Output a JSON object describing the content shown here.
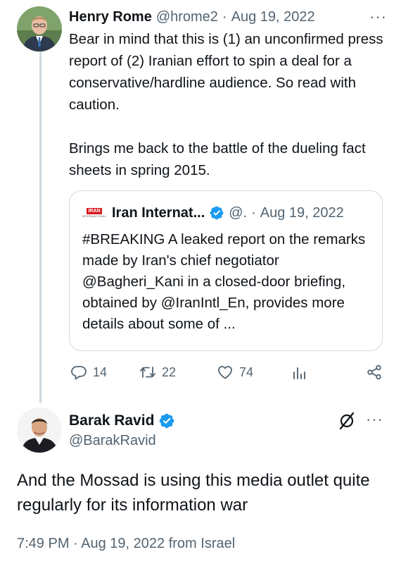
{
  "tweet1": {
    "author_name": "Henry Rome",
    "author_handle": "@hrome2",
    "separator": "·",
    "date": "Aug 19, 2022",
    "more_icon": "more-horizontal-icon",
    "more_label": "···",
    "paragraphs": [
      "Bear in mind that this is (1) an unconfirmed press report of (2) Iranian effort to spin a deal for a conservative/hardline audience. So read with caution.",
      "Brings me back to the battle of the dueling fact sheets in spring 2015."
    ],
    "quote": {
      "logo_text_top": "IRAN",
      "logo_text_bottom": "INTERNATIONAL",
      "author_name": "Iran Internat...",
      "author_handle": "@.",
      "separator": "·",
      "date": "Aug 19, 2022",
      "text": "#BREAKING A leaked report on the remarks made by Iran's chief negotiator @Bagheri_Kani in a closed-door briefing, obtained by @IranIntl_En, provides more details about some of ..."
    },
    "actions": {
      "replies": "14",
      "retweets": "22",
      "likes": "74"
    }
  },
  "tweet2": {
    "author_name": "Barak Ravid",
    "author_handle": "@BarakRavid",
    "more_label": "···",
    "text": "And the Mossad is using this media outlet quite regularly for its information war",
    "footer": "7:49 PM · Aug 19, 2022 from Israel"
  },
  "colors": {
    "text_primary": "#0f1419",
    "text_secondary": "#536471",
    "border": "#cfd9de",
    "verified_blue": "#1d9bf0"
  }
}
